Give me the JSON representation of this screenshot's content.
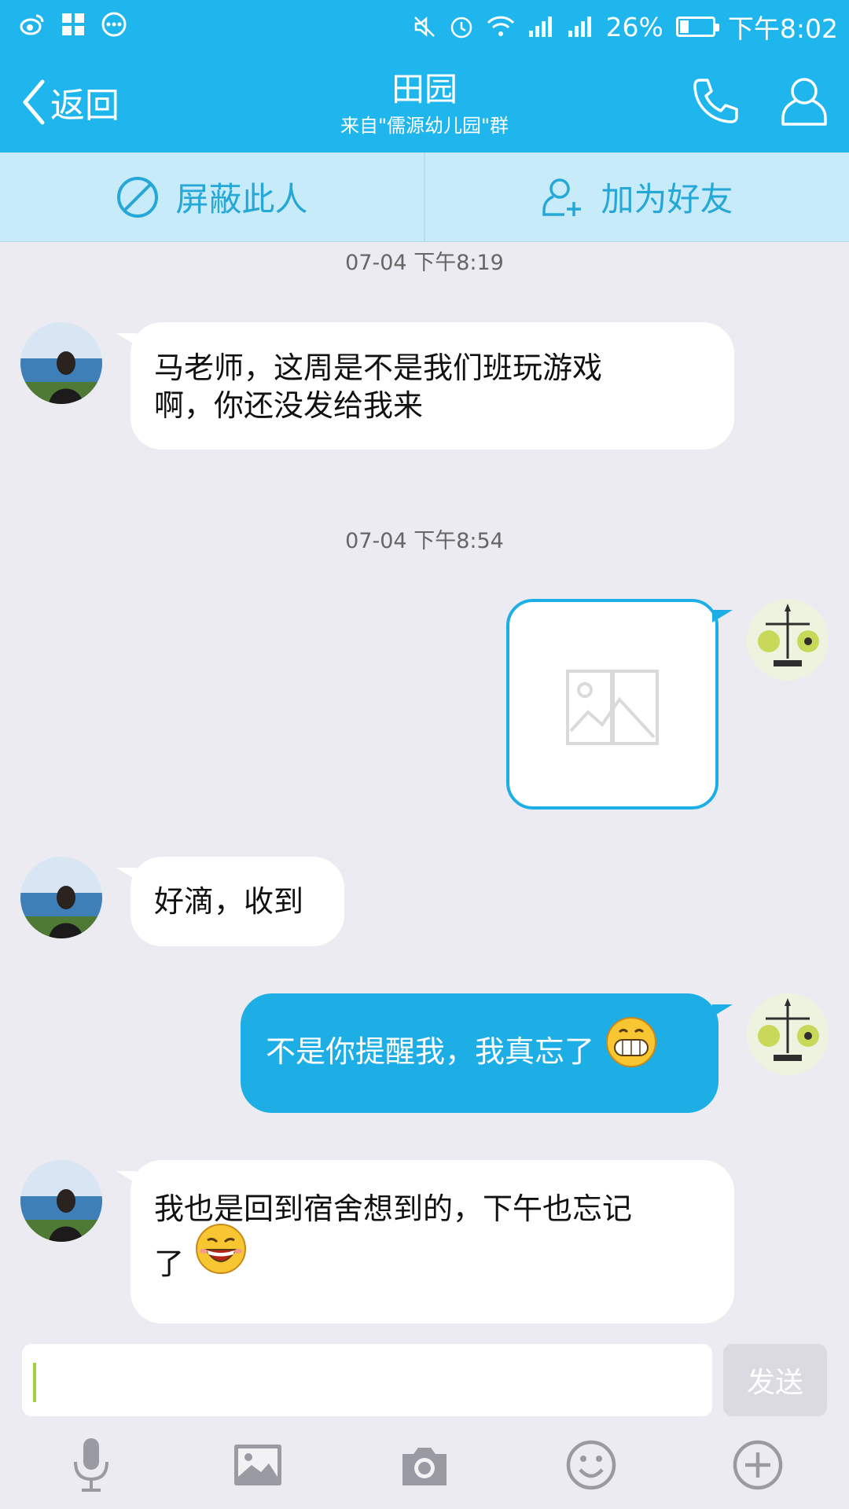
{
  "status_bar": {
    "battery_percent": "26%",
    "battery_level": 0.26,
    "time": "下午8:02",
    "left_icons": [
      "weibo-icon",
      "apps-icon",
      "more-dots-icon"
    ],
    "right_icons": [
      "mute-icon",
      "alarm-icon",
      "wifi-icon",
      "signal-icon",
      "signal-icon"
    ]
  },
  "header": {
    "back_label": "返回",
    "title": "田园",
    "subtitle": "来自\"儒源幼儿园\"群",
    "icons": [
      "phone-icon",
      "profile-icon"
    ]
  },
  "actions": {
    "block_label": "屏蔽此人",
    "add_friend_label": "加为好友"
  },
  "messages": [
    {
      "type": "time",
      "text": "07-04 下午8:19"
    },
    {
      "type": "text",
      "side": "left",
      "line1": "马老师，这周是不是我们班玩游戏",
      "line2": "啊，你还没发给我来"
    },
    {
      "type": "time",
      "text": "07-04 下午8:54"
    },
    {
      "type": "image",
      "side": "right",
      "icon": "image-placeholder-icon"
    },
    {
      "type": "text",
      "side": "left",
      "line1": "好滴，收到"
    },
    {
      "type": "text",
      "side": "right",
      "line1": "不是你提醒我，我真忘了",
      "emoji": "grin-emoji"
    },
    {
      "type": "text",
      "side": "left",
      "line1": "我也是回到宿舍想到的，下午也忘记",
      "line2": "了",
      "emoji": "laugh-emoji"
    }
  ],
  "input": {
    "value": "",
    "send_label": "发送"
  },
  "toolbar": {
    "icons": [
      "microphone-icon",
      "picture-icon",
      "camera-icon",
      "emoji-icon",
      "plus-icon"
    ]
  },
  "colors": {
    "accent": "#1eb6ec",
    "bubble_right": "#1eaee6",
    "action_bar": "#c7ebf8",
    "background": "#ebebf1"
  }
}
